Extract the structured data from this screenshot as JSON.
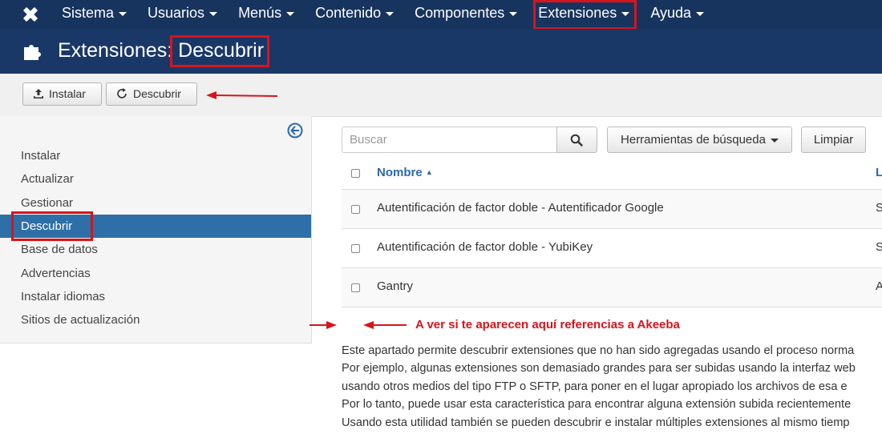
{
  "nav": {
    "items": [
      "Sistema",
      "Usuarios",
      "Menús",
      "Contenido",
      "Componentes",
      "Extensiones",
      "Ayuda"
    ]
  },
  "header": {
    "title_prefix": "Extensiones:",
    "title_highlight": "Descubrir"
  },
  "toolbar": {
    "install_label": "Instalar",
    "discover_label": "Descubrir"
  },
  "sidebar": {
    "items": [
      "Instalar",
      "Actualizar",
      "Gestionar",
      "Descubrir",
      "Base de datos",
      "Advertencias",
      "Instalar idiomas",
      "Sitios de actualización"
    ],
    "active_index": 3
  },
  "filters": {
    "search_placeholder": "Buscar",
    "tools_label": "Herramientas de búsqueda",
    "clear_label": "Limpiar"
  },
  "table": {
    "name_header": "Nombre",
    "next_header_cut": "L",
    "rows": [
      {
        "name": "Autentificación de factor doble - Autentificador Google",
        "next_cut": "S"
      },
      {
        "name": "Autentificación de factor doble - YubiKey",
        "next_cut": "S"
      },
      {
        "name": "Gantry",
        "next_cut": "A"
      }
    ]
  },
  "annotation": {
    "text": "A ver si te aparecen aquí referencias a Akeeba",
    "color": "#d8141b"
  },
  "description": {
    "lines": [
      "Este apartado permite descubrir extensiones que no han sido agregadas usando el proceso norma",
      "Por ejemplo, algunas extensiones son demasiado grandes para ser subidas usando la interfaz web",
      "usando otros medios del tipo FTP o SFTP, para poner en el lugar apropiado los archivos de esa e",
      "Por lo tanto, puede usar esta característica para encontrar alguna extensión subida recientemente",
      "Usando esta utilidad también se pueden descubrir e instalar múltiples extensiones al mismo tiemp"
    ]
  },
  "colors": {
    "nav_bg": "#17345e",
    "header_bg": "#1a3867",
    "sidebar_active": "#2f6fa7",
    "link": "#2a69b0",
    "highlight_red": "#d8141b"
  },
  "icons": [
    "joomla-logo-icon",
    "puzzle-icon",
    "upload-icon",
    "refresh-icon",
    "collapse-left-icon",
    "search-icon"
  ]
}
